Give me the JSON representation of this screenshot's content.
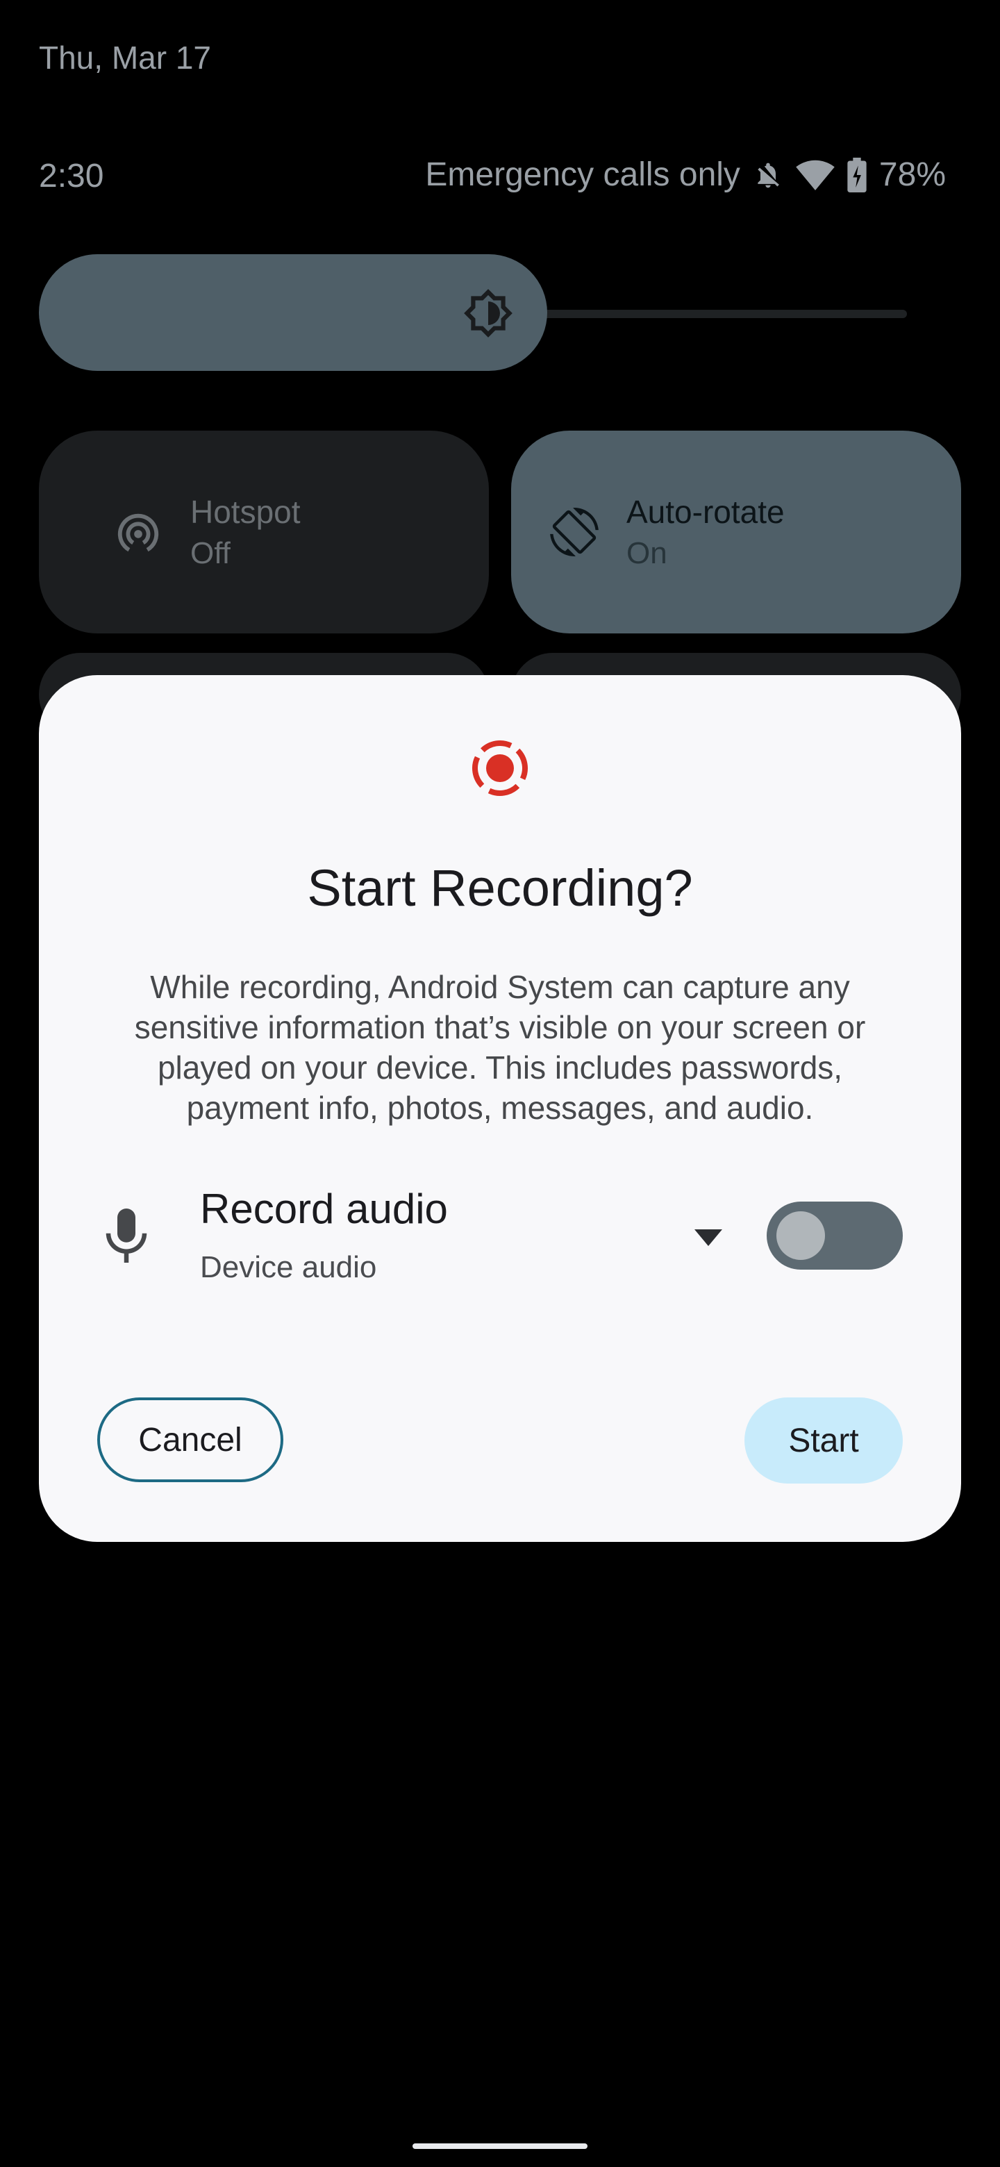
{
  "status": {
    "date": "Thu, Mar 17",
    "time": "2:30",
    "network_text": "Emergency calls only",
    "battery": "78%",
    "icons": [
      "bell-off-icon",
      "wifi-icon",
      "battery-charging-icon"
    ]
  },
  "brightness": {
    "icon": "brightness-icon",
    "level": 0.56
  },
  "tiles": [
    {
      "label": "Hotspot",
      "state": "Off",
      "icon": "hotspot-icon"
    },
    {
      "label": "Auto-rotate",
      "state": "On",
      "icon": "rotate-icon"
    }
  ],
  "dialog": {
    "icon": "screen-record-icon",
    "title": "Start Recording?",
    "body": "While recording, Android System can capture any sensitive information that’s visible on your screen or played on your device. This includes passwords, payment info, photos, messages, and audio.",
    "record_audio": {
      "label": "Record audio",
      "source": "Device audio",
      "enabled": false
    },
    "cancel_label": "Cancel",
    "start_label": "Start"
  },
  "colors": {
    "accent_red": "#d93025",
    "tile_active": "#4f5f68",
    "start_button": "#c8ebfb",
    "cancel_outline": "#1d6a84"
  }
}
